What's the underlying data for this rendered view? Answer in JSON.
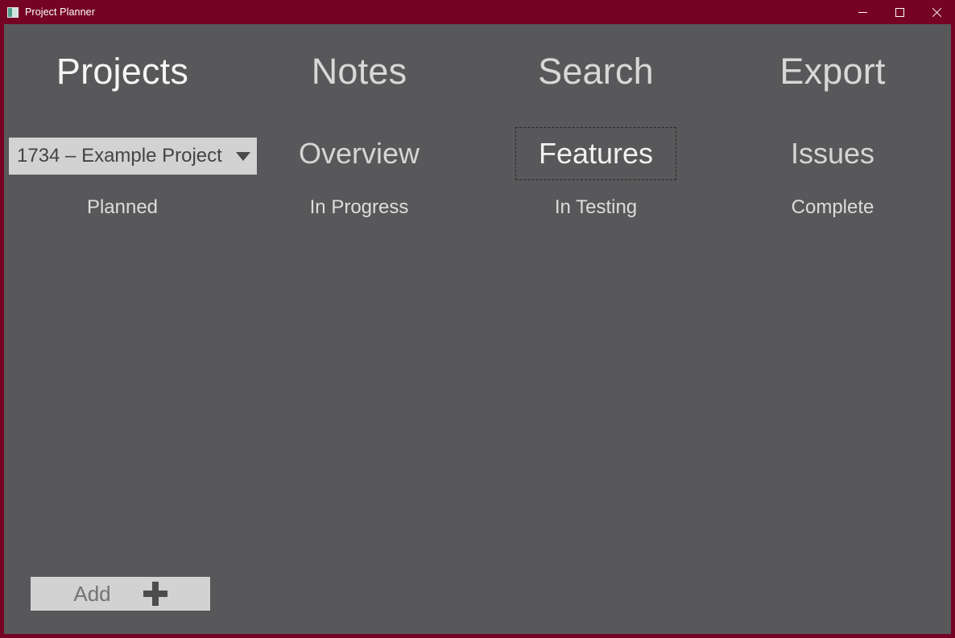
{
  "window": {
    "title": "Project Planner",
    "icon": "app-window-icon",
    "border_color": "#750424",
    "titlebar_color": "#750424",
    "client_color": "#58585a",
    "controls": [
      {
        "name": "minimize",
        "glyph": "minimize-icon"
      },
      {
        "name": "maximize",
        "glyph": "maximize-icon"
      },
      {
        "name": "close",
        "glyph": "close-icon"
      }
    ]
  },
  "nav": {
    "items": [
      {
        "label": "Projects",
        "active": true
      },
      {
        "label": "Notes",
        "active": false
      },
      {
        "label": "Search",
        "active": false
      },
      {
        "label": "Export",
        "active": false
      }
    ]
  },
  "project_select": {
    "value": "1734 – Example Project",
    "arrow": "chevron-down-icon"
  },
  "subnav": {
    "items": [
      {
        "label": "Overview",
        "focused": false
      },
      {
        "label": "Features",
        "focused": true
      },
      {
        "label": "Issues",
        "focused": false
      }
    ]
  },
  "status_row": {
    "items": [
      {
        "label": "Planned"
      },
      {
        "label": "In Progress"
      },
      {
        "label": "In Testing"
      },
      {
        "label": "Complete"
      }
    ]
  },
  "add_button": {
    "label": "Add",
    "icon": "plus-icon"
  }
}
